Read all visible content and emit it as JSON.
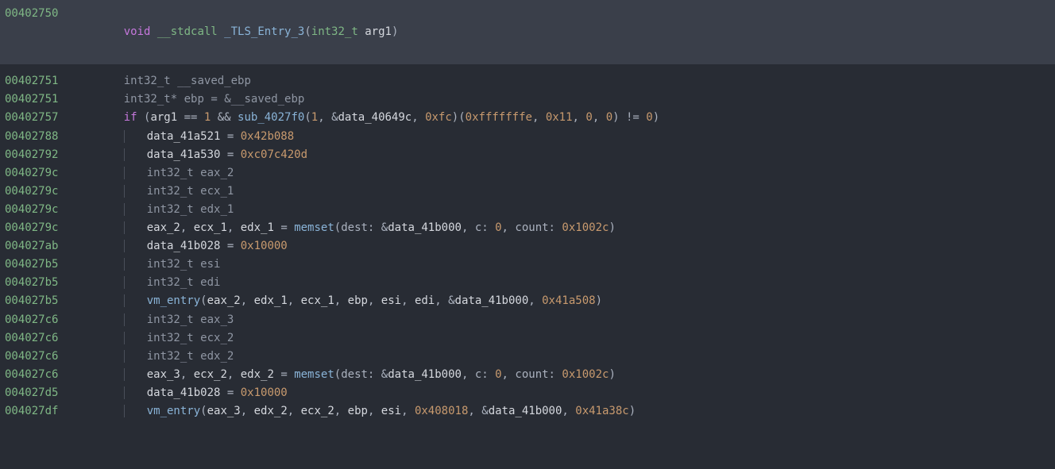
{
  "header": {
    "addr": "00402750",
    "kw_void": "void",
    "kw_stdcall": "__stdcall",
    "func_name": "_TLS_Entry_3",
    "param_type": "int32_t",
    "param_name": "arg1"
  },
  "lines": {
    "l1": {
      "addr": "00402751",
      "type": "int32_t",
      "var": "__saved_ebp"
    },
    "l2": {
      "addr": "00402751",
      "type": "int32_t*",
      "var": "ebp",
      "eq": " = ",
      "amp": "&",
      "ref": "__saved_ebp"
    },
    "l3": {
      "addr": "00402757",
      "kw_if": "if",
      "lp": " (",
      "arg1": "arg1",
      "eqop": " == ",
      "one": "1",
      "andop": " && ",
      "sub": "sub_4027f0",
      "a1": "1",
      "a2": "data_40649c",
      "a3": "0xfc",
      "b1": "0xfffffffe",
      "b2": "0x11",
      "b3": "0",
      "b4": "0",
      "neq": " != ",
      "zero": "0",
      "rp": ")"
    },
    "l4": {
      "addr": "00402788",
      "var": "data_41a521",
      "eq": " = ",
      "val": "0x42b088"
    },
    "l5": {
      "addr": "00402792",
      "var": "data_41a530",
      "eq": " = ",
      "val": "0xc07c420d"
    },
    "l6": {
      "addr": "0040279c",
      "type": "int32_t",
      "var": "eax_2"
    },
    "l7": {
      "addr": "0040279c",
      "type": "int32_t",
      "var": "ecx_1"
    },
    "l8": {
      "addr": "0040279c",
      "type": "int32_t",
      "var": "edx_1"
    },
    "l9": {
      "addr": "0040279c",
      "v1": "eax_2",
      "v2": "ecx_1",
      "v3": "edx_1",
      "eq": " = ",
      "fn": "memset",
      "k1": "dest: ",
      "a1": "data_41b000",
      "k2": "c: ",
      "a2": "0",
      "k3": "count: ",
      "a3": "0x1002c"
    },
    "l10": {
      "addr": "004027ab",
      "var": "data_41b028",
      "eq": " = ",
      "val": "0x10000"
    },
    "l11": {
      "addr": "004027b5",
      "type": "int32_t",
      "var": "esi"
    },
    "l12": {
      "addr": "004027b5",
      "type": "int32_t",
      "var": "edi"
    },
    "l13": {
      "addr": "004027b5",
      "fn": "vm_entry",
      "a1": "eax_2",
      "a2": "edx_1",
      "a3": "ecx_1",
      "a4": "ebp",
      "a5": "esi",
      "a6": "edi",
      "a7": "data_41b000",
      "a8": "0x41a508"
    },
    "l14": {
      "addr": "004027c6",
      "type": "int32_t",
      "var": "eax_3"
    },
    "l15": {
      "addr": "004027c6",
      "type": "int32_t",
      "var": "ecx_2"
    },
    "l16": {
      "addr": "004027c6",
      "type": "int32_t",
      "var": "edx_2"
    },
    "l17": {
      "addr": "004027c6",
      "v1": "eax_3",
      "v2": "ecx_2",
      "v3": "edx_2",
      "eq": " = ",
      "fn": "memset",
      "k1": "dest: ",
      "a1": "data_41b000",
      "k2": "c: ",
      "a2": "0",
      "k3": "count: ",
      "a3": "0x1002c"
    },
    "l18": {
      "addr": "004027d5",
      "var": "data_41b028",
      "eq": " = ",
      "val": "0x10000"
    },
    "l19": {
      "addr": "004027df",
      "fn": "vm_entry",
      "a1": "eax_3",
      "a2": "edx_2",
      "a3": "ecx_2",
      "a4": "ebp",
      "a5": "esi",
      "a6": "0x408018",
      "a7": "data_41b000",
      "a8": "0x41a38c"
    }
  }
}
